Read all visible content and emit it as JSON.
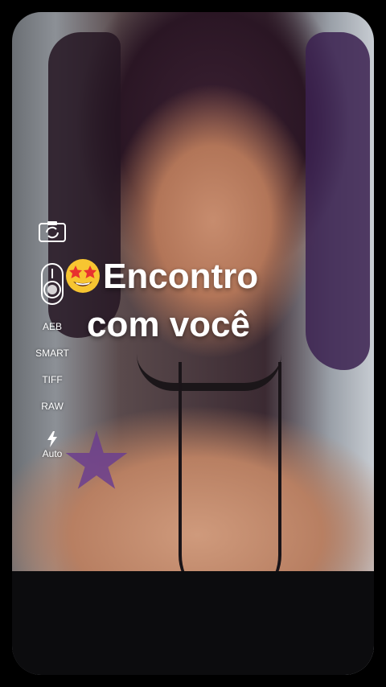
{
  "camera_tools": {
    "switch_camera_icon": "camera-switch-icon",
    "shutter_icon": "shutter-dial-icon",
    "aeb": "AEB",
    "smart": "SMART",
    "tiff": "TIFF",
    "raw": "RAW",
    "flash_icon": "lightning-icon",
    "flash_mode": "Auto"
  },
  "caption": {
    "emoji": "star-struck-emoji",
    "line1": "Encontro",
    "line2": "com você"
  },
  "colors": {
    "caption_text": "#ffffff",
    "ui_text": "#ffffff",
    "frame_bg": "#000000"
  }
}
